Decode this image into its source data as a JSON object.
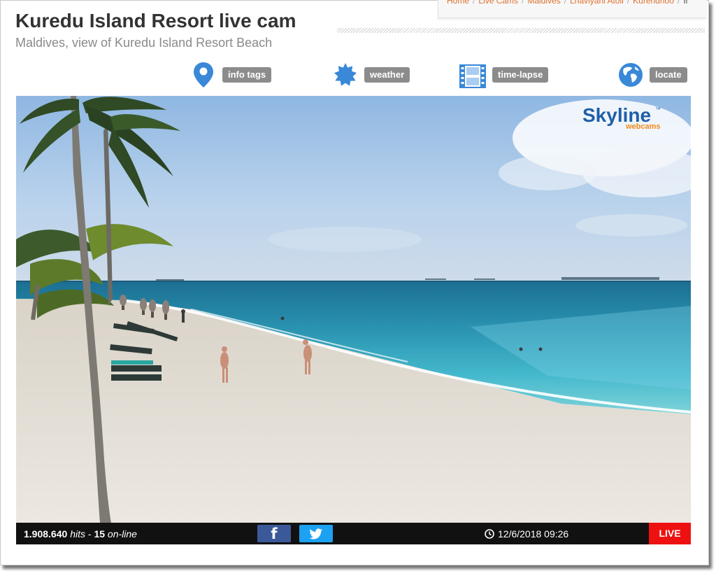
{
  "page": {
    "title_strong": "Kuredu Island Resort",
    "title_rest": "live cam",
    "subtitle": "Maldives, view of Kuredu Island Resort Beach"
  },
  "breadcrumb": {
    "items": [
      "Home",
      "Live Cams",
      "Maldives",
      "Lhaviyani Atoll",
      "Kurendhoo"
    ],
    "current": "Ir"
  },
  "toolbar": {
    "info_tags": {
      "label": "info tags",
      "icon": "map-pin-icon"
    },
    "weather": {
      "label": "weather",
      "icon": "sun-badge-icon"
    },
    "timelapse": {
      "label": "time-lapse",
      "icon": "film-strip-icon"
    },
    "locate": {
      "label": "locate",
      "icon": "globe-icon"
    }
  },
  "player": {
    "logo_main": "Skyline",
    "logo_tm": "™",
    "logo_sub": "webcams"
  },
  "status_bar": {
    "hits": "1.908.640",
    "hits_label": "hits",
    "dash": "-",
    "online": "15",
    "online_label": "on-line",
    "datetime": "12/6/2018 09:26",
    "live": "LIVE"
  },
  "colors": {
    "breadcrumb_link": "#e0702e",
    "icon_blue": "#3a88d8",
    "facebook": "#3b5998",
    "twitter": "#1da1f2",
    "live_red": "#ee1111",
    "label_grey": "#8c8c8c"
  }
}
